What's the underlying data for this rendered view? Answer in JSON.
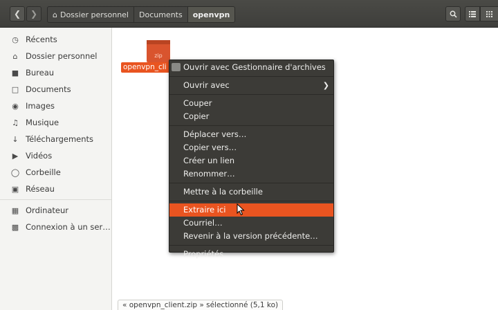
{
  "header": {
    "crumbs": [
      "Dossier personnel",
      "Documents",
      "openvpn"
    ]
  },
  "sidebar": {
    "group1": [
      {
        "label": "Récents",
        "icon": "clock-icon"
      },
      {
        "label": "Dossier personnel",
        "icon": "home-icon"
      },
      {
        "label": "Bureau",
        "icon": "folder-icon"
      },
      {
        "label": "Documents",
        "icon": "document-icon"
      },
      {
        "label": "Images",
        "icon": "camera-icon"
      },
      {
        "label": "Musique",
        "icon": "music-icon"
      },
      {
        "label": "Téléchargements",
        "icon": "download-icon"
      },
      {
        "label": "Vidéos",
        "icon": "video-icon"
      },
      {
        "label": "Corbeille",
        "icon": "trash-icon"
      },
      {
        "label": "Réseau",
        "icon": "network-icon"
      }
    ],
    "group2": [
      {
        "label": "Ordinateur",
        "icon": "computer-icon"
      },
      {
        "label": "Connexion à un ser…",
        "icon": "server-icon"
      }
    ]
  },
  "file": {
    "label": "openvpn_cli",
    "type_badge": "zip"
  },
  "menu": {
    "open_with_archive": "Ouvrir avec Gestionnaire d'archives",
    "open_with": "Ouvrir avec",
    "cut": "Couper",
    "copy": "Copier",
    "move_to": "Déplacer vers…",
    "copy_to": "Copier vers…",
    "create_link": "Créer un lien",
    "rename": "Renommer…",
    "trash": "Mettre à la corbeille",
    "extract_here": "Extraire ici",
    "email": "Courriel…",
    "revert": "Revenir à la version précédente…",
    "properties": "Propriétés"
  },
  "status": {
    "text": "« openvpn_client.zip » sélectionné (5,1 ko)"
  },
  "colors": {
    "accent": "#e95420",
    "menu_bg": "#3c3b37",
    "header_bg": "#41413e"
  }
}
